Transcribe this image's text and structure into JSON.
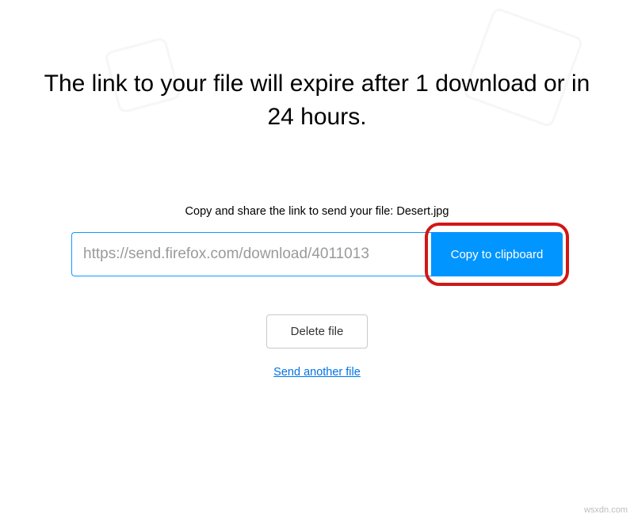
{
  "heading": "The link to your file will expire after 1 download or in 24 hours.",
  "share": {
    "instruction_prefix": "Copy and share the link to send your file: ",
    "filename": "Desert.jpg",
    "link_value": "https://send.firefox.com/download/4011013",
    "copy_button_label": "Copy to clipboard"
  },
  "actions": {
    "delete_label": "Delete file",
    "send_another_label": "Send another file"
  },
  "watermark": "wsxdn.com"
}
